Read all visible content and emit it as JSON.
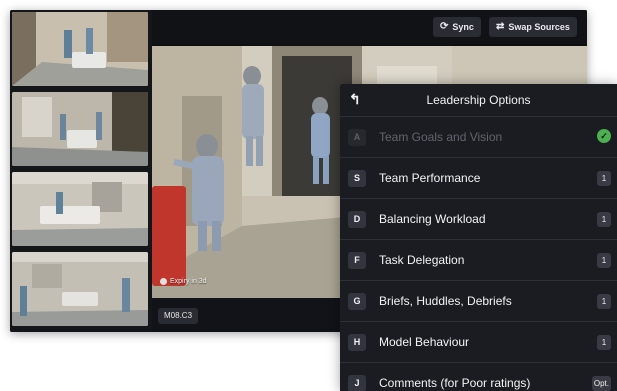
{
  "toolbar": {
    "sync_label": "Sync",
    "swap_label": "Swap Sources"
  },
  "video": {
    "expiry": "Expiry in 3d",
    "camera_label": "M08.C3"
  },
  "thumbnails": [
    {
      "active": true
    },
    {
      "active": false
    },
    {
      "active": false
    },
    {
      "active": false
    }
  ],
  "panel": {
    "back_icon": "back-arrow-icon",
    "title": "Leadership Options",
    "options": [
      {
        "key": "A",
        "label": "Team Goals and Vision",
        "status": "done"
      },
      {
        "key": "S",
        "label": "Team Performance",
        "badge": "1"
      },
      {
        "key": "D",
        "label": "Balancing Workload",
        "badge": "1"
      },
      {
        "key": "F",
        "label": "Task Delegation",
        "badge": "1"
      },
      {
        "key": "G",
        "label": "Briefs, Huddles, Debriefs",
        "badge": "1"
      },
      {
        "key": "H",
        "label": "Model Behaviour",
        "badge": "1"
      },
      {
        "key": "J",
        "label": "Comments (for Poor ratings)",
        "badge": "Opt."
      }
    ]
  },
  "colors": {
    "panel_bg": "#1a1c22",
    "check_green": "#4caf50",
    "button_bg": "#2a2c33"
  }
}
